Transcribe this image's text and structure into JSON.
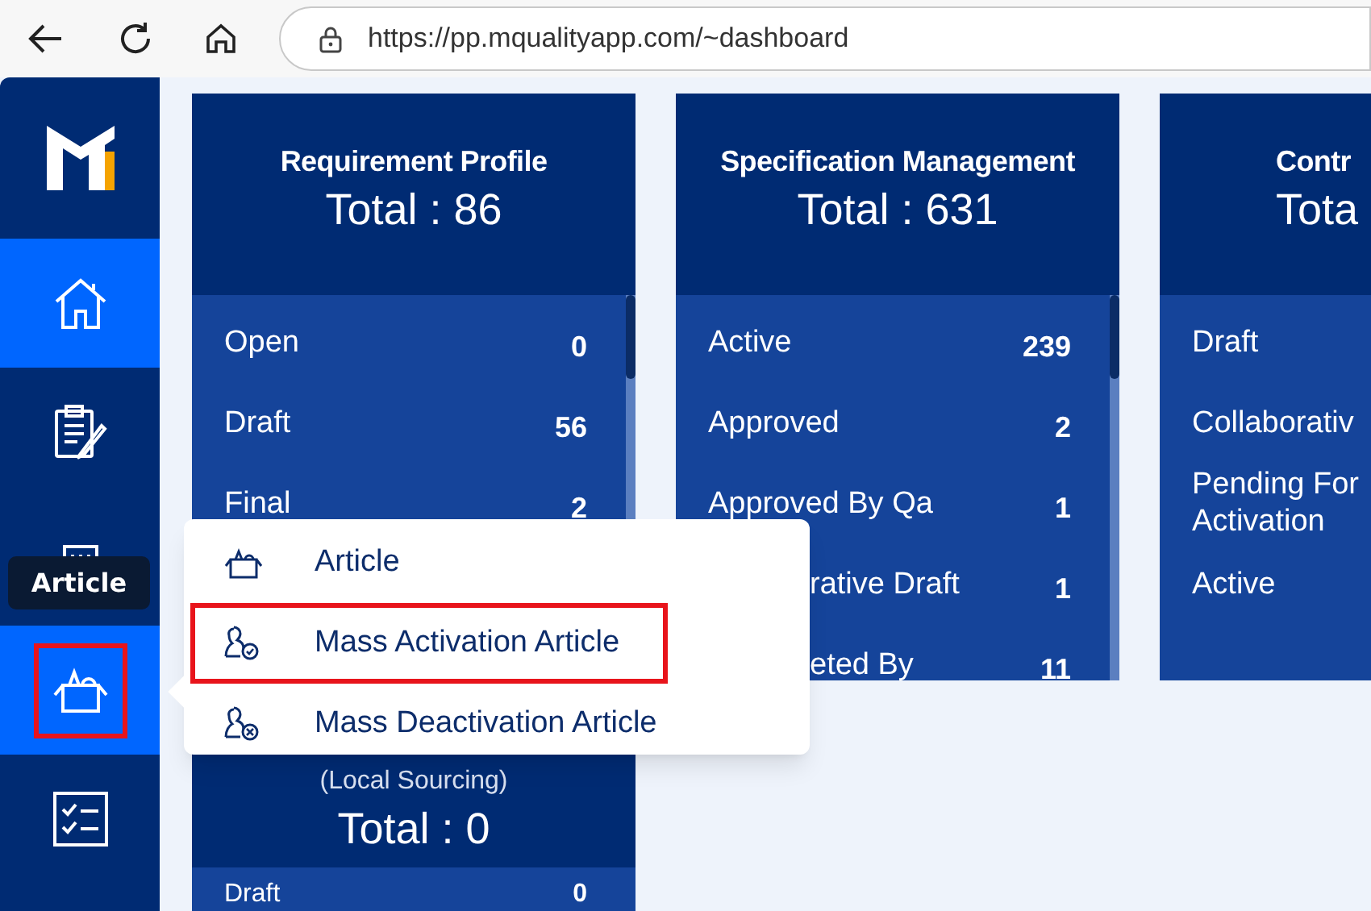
{
  "browser": {
    "url": "https://pp.mqualityapp.com/~dashboard"
  },
  "sidebar": {
    "items": [
      {
        "kind": "home",
        "selected": true,
        "highlighted": false
      },
      {
        "kind": "clipboard",
        "selected": false,
        "highlighted": false
      },
      {
        "kind": "board",
        "selected": false,
        "highlighted": false
      },
      {
        "kind": "article",
        "selected": true,
        "highlighted": true
      },
      {
        "kind": "checklist",
        "selected": false,
        "highlighted": false
      }
    ]
  },
  "tooltip": {
    "text": "Article"
  },
  "cards": [
    {
      "kind": "full",
      "title": "Requirement Profile",
      "total": "Total : 86",
      "rows": [
        {
          "kind": "plain",
          "label": "Open",
          "value": "0"
        },
        {
          "kind": "plain",
          "label": "Draft",
          "value": "56"
        },
        {
          "kind": "plain",
          "label": "Final",
          "value": "2"
        }
      ]
    },
    {
      "kind": "full",
      "title": "Specification Management",
      "total": "Total : 631",
      "rows": [
        {
          "kind": "plain",
          "label": "Active",
          "value": "239"
        },
        {
          "kind": "plain",
          "label": "Approved",
          "value": "2"
        },
        {
          "kind": "plain",
          "label": "Approved By Qa",
          "value": "1"
        },
        {
          "kind": "covered",
          "label": "rative Draft",
          "value": "1"
        },
        {
          "kind": "covered",
          "label": "eted By",
          "value": "11"
        }
      ]
    },
    {
      "kind": "edge",
      "title": "Contr",
      "total": "Tota",
      "rows": [
        {
          "kind": "plain",
          "label": "Draft"
        },
        {
          "kind": "plain",
          "label": "Collaborativ"
        },
        {
          "kind": "plain",
          "label": "Pending For Activation"
        },
        {
          "kind": "plain",
          "label": "Active"
        }
      ]
    },
    {
      "kind": "lower",
      "subtitle": "(Local Sourcing)",
      "total": "Total : 0",
      "rows": [
        {
          "kind": "plain",
          "label": "Draft",
          "value": "0"
        }
      ]
    }
  ],
  "popup_menu": {
    "items": [
      {
        "kind": "box",
        "label": "Article",
        "highlighted": false
      },
      {
        "kind": "activate",
        "label": "Mass Activation Article",
        "highlighted": true
      },
      {
        "kind": "deactivate",
        "label": "Mass Deactivation Article",
        "highlighted": false
      }
    ]
  }
}
